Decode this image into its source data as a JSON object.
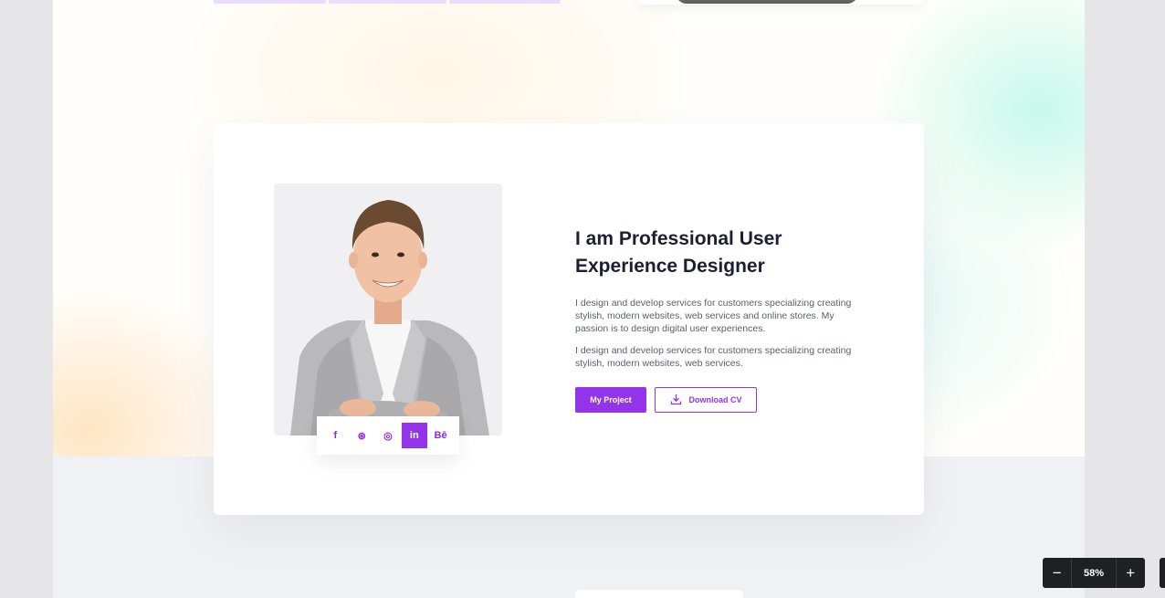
{
  "about": {
    "heading": "I am Professional User Experience Designer",
    "paragraph_1": "I design and develop services for customers specializing creating stylish, modern websites, web services and online stores. My passion is to design digital user experiences.",
    "paragraph_2": "I design and develop services for customers specializing creating stylish, modern websites, web services.",
    "primary_button": "My Project",
    "secondary_button": "Download CV",
    "social": [
      {
        "icon": "facebook-icon",
        "glyph": "f",
        "active": false
      },
      {
        "icon": "dribbble-icon",
        "glyph": "⊛",
        "active": false
      },
      {
        "icon": "instagram-icon",
        "glyph": "◎",
        "active": false
      },
      {
        "icon": "linkedin-icon",
        "glyph": "in",
        "active": true
      },
      {
        "icon": "behance-icon",
        "glyph": "Bē",
        "active": false
      }
    ]
  },
  "zoom": {
    "value": "58%",
    "minus": "−",
    "plus": "+"
  },
  "colors": {
    "accent": "#9333ea",
    "heading": "#1b1f33",
    "body_text": "#5a5f6e",
    "zoom_bg": "#1f2023"
  }
}
